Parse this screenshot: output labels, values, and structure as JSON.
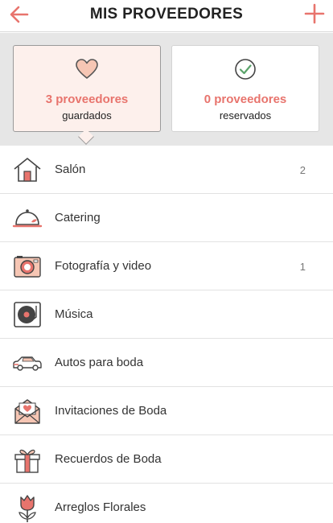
{
  "header": {
    "title": "MIS PROVEEDORES"
  },
  "summary": {
    "saved": {
      "count": "3 proveedores",
      "label": "guardados"
    },
    "reserved": {
      "count": "0 proveedores",
      "label": "reservados"
    }
  },
  "categories": [
    {
      "label": "Salón",
      "count": "2",
      "icon": "house-icon"
    },
    {
      "label": "Catering",
      "count": "",
      "icon": "food-cloche-icon"
    },
    {
      "label": "Fotografía y video",
      "count": "1",
      "icon": "camera-icon"
    },
    {
      "label": "Música",
      "count": "",
      "icon": "turntable-icon"
    },
    {
      "label": "Autos para boda",
      "count": "",
      "icon": "car-icon"
    },
    {
      "label": "Invitaciones de Boda",
      "count": "",
      "icon": "envelope-heart-icon"
    },
    {
      "label": "Recuerdos de Boda",
      "count": "",
      "icon": "gift-icon"
    },
    {
      "label": "Arreglos Florales",
      "count": "",
      "icon": "tulip-icon"
    }
  ],
  "colors": {
    "accent": "#e8746d",
    "panel": "#e6e6e6",
    "active_card": "#fdf0ec"
  }
}
